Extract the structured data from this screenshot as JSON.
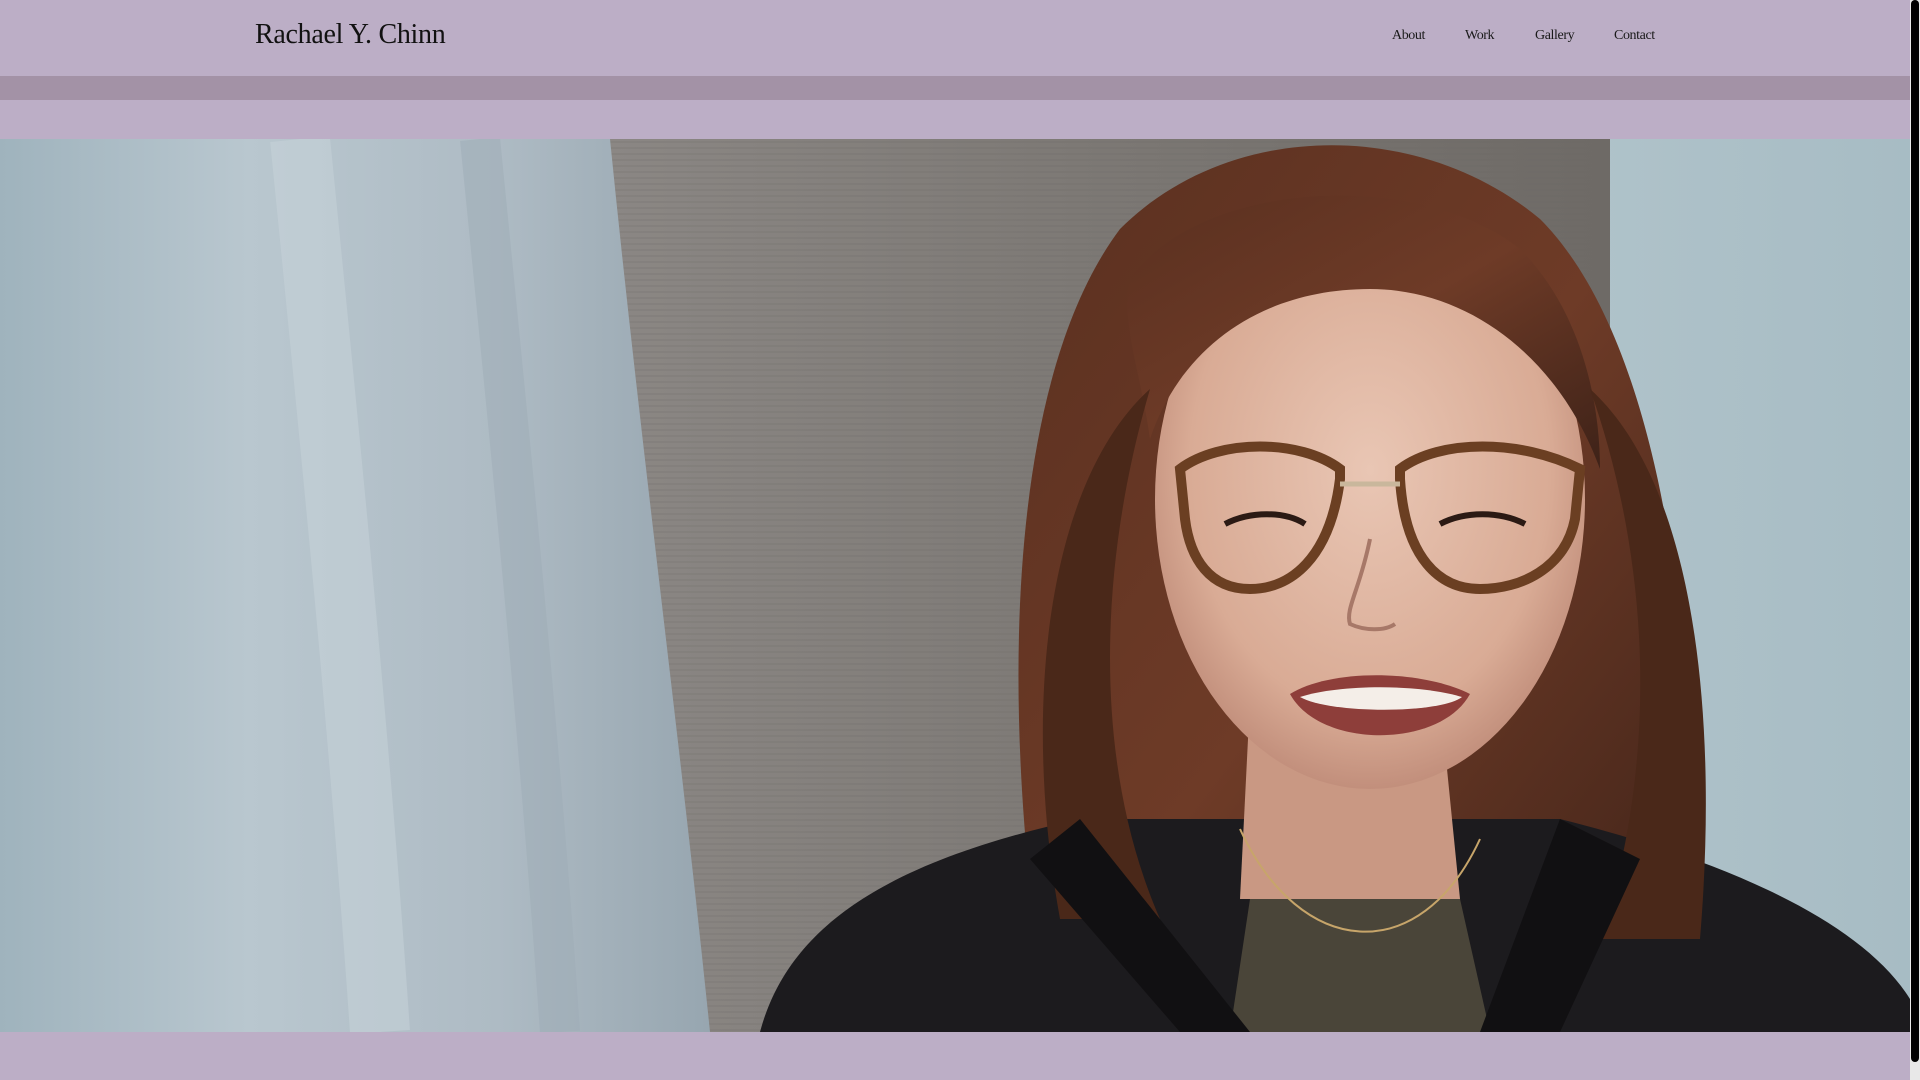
{
  "header": {
    "site_title": "Rachael Y. Chinn",
    "nav": [
      {
        "label": "About"
      },
      {
        "label": "Work"
      },
      {
        "label": "Gallery"
      },
      {
        "label": "Contact"
      }
    ]
  },
  "colors": {
    "header_bg": "#bcaec6",
    "strip_bg": "#a392a6",
    "text": "#111111"
  },
  "hero": {
    "image_name": "portrait-photo"
  }
}
